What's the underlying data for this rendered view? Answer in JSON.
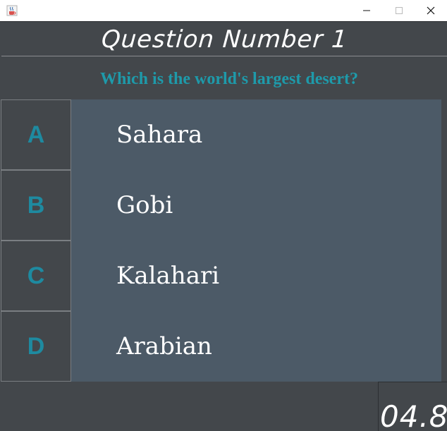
{
  "window": {
    "minimize_glyph": "—",
    "maximize_glyph": "☐",
    "close_glyph": "✕"
  },
  "question": {
    "header": "Question Number 1",
    "text": "Which is the world's largest desert?"
  },
  "options": [
    {
      "letter": "A",
      "answer": "Sahara"
    },
    {
      "letter": "B",
      "answer": "Gobi"
    },
    {
      "letter": "C",
      "answer": "Kalahari"
    },
    {
      "letter": "D",
      "answer": "Arabian"
    }
  ],
  "timer": {
    "value": "04.8"
  },
  "colors": {
    "background": "#43474b",
    "answer_panel": "#4c5a67",
    "accent_teal": "#1e9aaa",
    "text_white": "#ffffff"
  },
  "icons": {
    "app": "java-coffee-cup-icon"
  }
}
